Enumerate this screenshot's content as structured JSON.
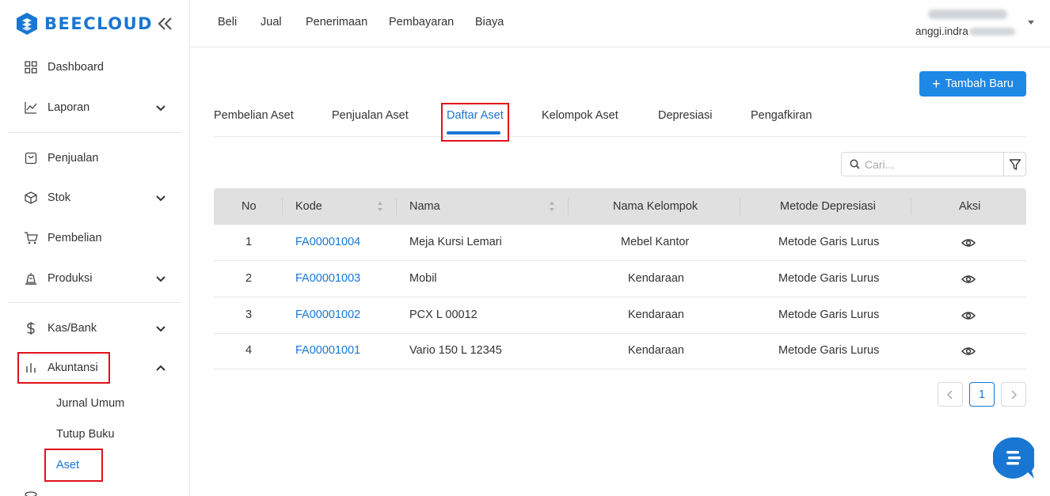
{
  "brand": {
    "name": "BEECLOUD",
    "color": "#1976d2"
  },
  "sidebar": {
    "items": [
      {
        "label": "Dashboard",
        "icon": "grid-icon"
      },
      {
        "label": "Laporan",
        "icon": "line-chart-icon"
      },
      {
        "label": "Penjualan",
        "icon": "shopping-bag-icon"
      },
      {
        "label": "Stok",
        "icon": "box-icon"
      },
      {
        "label": "Pembelian",
        "icon": "cart-icon"
      },
      {
        "label": "Produksi",
        "icon": "factory-icon"
      },
      {
        "label": "Kas/Bank",
        "icon": "dollar-icon"
      },
      {
        "label": "Akuntansi",
        "icon": "bar-chart-icon"
      }
    ],
    "akuntansi_sub": [
      {
        "label": "Jurnal Umum"
      },
      {
        "label": "Tutup Buku"
      },
      {
        "label": "Aset"
      }
    ]
  },
  "topbar": {
    "menus": [
      "Beli",
      "Jual",
      "Penerimaan",
      "Pembayaran",
      "Biaya"
    ],
    "user_email": "anggi.indra"
  },
  "main": {
    "add_button": "Tambah Baru",
    "tabs": [
      "Pembelian Aset",
      "Penjualan Aset",
      "Daftar Aset",
      "Kelompok Aset",
      "Depresiasi",
      "Pengafkiran"
    ],
    "active_tab": "Daftar Aset",
    "search_placeholder": "Cari...",
    "table": {
      "headers": [
        "No",
        "Kode",
        "Nama",
        "Nama Kelompok",
        "Metode Depresiasi",
        "Aksi"
      ],
      "rows": [
        {
          "no": "1",
          "kode": "FA00001004",
          "nama": "Meja Kursi Lemari",
          "kelompok": "Mebel Kantor",
          "metode": "Metode Garis Lurus"
        },
        {
          "no": "2",
          "kode": "FA00001003",
          "nama": "Mobil",
          "kelompok": "Kendaraan",
          "metode": "Metode Garis Lurus"
        },
        {
          "no": "3",
          "kode": "FA00001002",
          "nama": "PCX L 00012",
          "kelompok": "Kendaraan",
          "metode": "Metode Garis Lurus"
        },
        {
          "no": "4",
          "kode": "FA00001001",
          "nama": "Vario 150 L 12345",
          "kelompok": "Kendaraan",
          "metode": "Metode Garis Lurus"
        }
      ]
    },
    "pagination": {
      "current_page": "1"
    }
  }
}
